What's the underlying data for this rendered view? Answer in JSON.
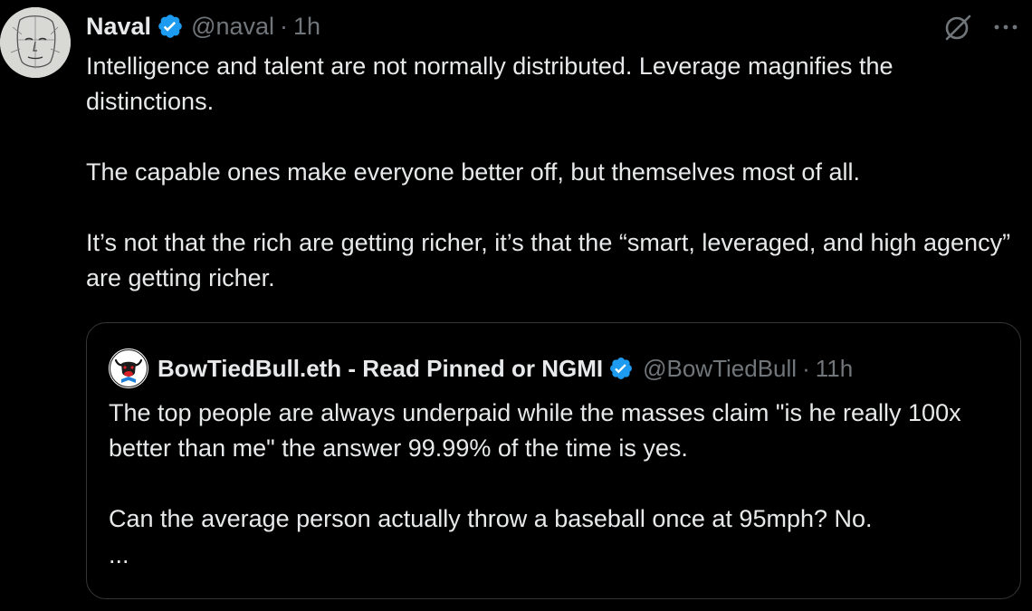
{
  "colors": {
    "background": "#000000",
    "primary_text": "#e7e9ea",
    "secondary_text": "#71767b",
    "verified_badge": "#1d9bf0",
    "quote_border": "#333639"
  },
  "tweet": {
    "author": {
      "name": "Naval",
      "handle": "@naval",
      "verified": true,
      "avatar_icon": "sketch-face-avatar"
    },
    "separator": "·",
    "time": "1h",
    "actions": {
      "grok_icon": "grok-icon",
      "more_icon": "more-dots-icon"
    },
    "paragraphs": [
      "Intelligence and talent are not normally distributed. Leverage magnifies the distinctions.",
      "The capable ones make everyone better off, but themselves most of all.",
      "It’s not that the rich are getting richer, it’s that the “smart, leveraged, and high agency” are getting richer."
    ]
  },
  "quote": {
    "author": {
      "name": "BowTiedBull.eth - Read Pinned or NGMI",
      "handle": "@BowTiedBull",
      "verified": true,
      "avatar_icon": "bull-avatar"
    },
    "separator": "·",
    "time": "11h",
    "paragraphs": [
      "The top people are always underpaid while the masses claim \"is he really 100x better than me\" the answer 99.99% of the time is yes.",
      "Can the average person actually throw a baseball once at 95mph? No."
    ],
    "ellipsis": "..."
  }
}
